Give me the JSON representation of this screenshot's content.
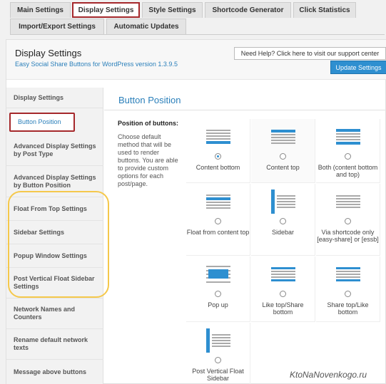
{
  "tabs": [
    {
      "label": "Main Settings"
    },
    {
      "label": "Display Settings"
    },
    {
      "label": "Style Settings"
    },
    {
      "label": "Shortcode Generator"
    },
    {
      "label": "Click Statistics"
    },
    {
      "label": "Import/Export Settings"
    },
    {
      "label": "Automatic Updates"
    }
  ],
  "header": {
    "title": "Display Settings",
    "subtitle": "Easy Social Share Buttons for WordPress version 1.3.9.5",
    "help_label": "Need Help? Click here to visit our support center",
    "update_label": "Update Settings"
  },
  "sidebar": {
    "items": [
      {
        "label": "Display Settings"
      },
      {
        "label": "Button Position"
      },
      {
        "label": "Advanced Display Settings by Post Type"
      },
      {
        "label": "Advanced Display Settings by Button Position"
      },
      {
        "label": "Float From Top Settings"
      },
      {
        "label": "Sidebar Settings"
      },
      {
        "label": "Popup Window Settings"
      },
      {
        "label": "Post Vertical Float Sidebar Settings"
      },
      {
        "label": "Network Names and Counters"
      },
      {
        "label": "Rename default network texts"
      },
      {
        "label": "Message above buttons"
      }
    ]
  },
  "main": {
    "section_title": "Button Position",
    "field_label": "Position of buttons:",
    "field_desc": "Choose default method that will be used to render buttons. You are able to provide custom options for each post/page.",
    "options": [
      {
        "label": "Content bottom",
        "icon": "content-bottom-icon",
        "selected": true
      },
      {
        "label": "Content top",
        "icon": "content-top-icon",
        "selected": false
      },
      {
        "label": "Both (content bottom and top)",
        "icon": "content-both-icon",
        "selected": false
      },
      {
        "label": "Float from content top",
        "icon": "float-top-icon",
        "selected": false
      },
      {
        "label": "Sidebar",
        "icon": "sidebar-icon",
        "selected": false
      },
      {
        "label": "Via shortcode only [easy-share] or [essb]",
        "icon": "shortcode-icon",
        "selected": false
      },
      {
        "label": "Pop up",
        "icon": "popup-icon",
        "selected": false
      },
      {
        "label": "Like top/Share bottom",
        "icon": "like-top-share-bottom-icon",
        "selected": false
      },
      {
        "label": "Share top/Like bottom",
        "icon": "share-top-like-bottom-icon",
        "selected": false
      },
      {
        "label": "Post Vertical Float Sidebar",
        "icon": "vertical-float-icon",
        "selected": false
      }
    ]
  },
  "watermark": "KtoNaNovenkogo.ru",
  "colors": {
    "accent": "#2e8fd0",
    "highlight_border": "#a5282b",
    "oval": "#f5c84b"
  }
}
